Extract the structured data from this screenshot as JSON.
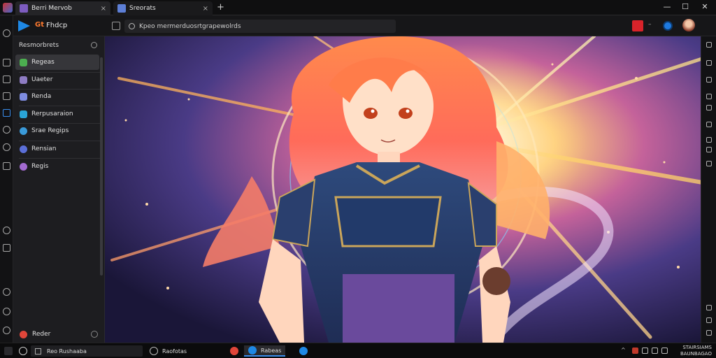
{
  "window": {
    "tabs": [
      {
        "label": "Berri Mervob",
        "close": "×"
      },
      {
        "label": "Sreorats",
        "close": "×"
      }
    ],
    "new_tab": "+",
    "controls": {
      "minimize": "—",
      "maximize": "☐",
      "close": "✕"
    }
  },
  "toolbar": {
    "brand_icon_text": "Gt",
    "brand_name": "Fhdcp",
    "address_value": "Kpeo mermerduosrtgrapewolrds"
  },
  "sidebar": {
    "header": "Resmorbrets",
    "items": [
      {
        "label": "Regeas",
        "color": "#4caf50",
        "selected": true
      },
      {
        "label": "Uaeter",
        "color": "#8e7cc3",
        "selected": false
      },
      {
        "label": "Renda",
        "color": "#7e8ce0",
        "selected": false
      },
      {
        "label": "Rerpusaraion",
        "color": "#2aa4d6",
        "selected": false
      },
      {
        "label": "Srae Regips",
        "color": "#3a9ad9",
        "selected": false
      },
      {
        "label": "Rensian",
        "color": "#5b6fd8",
        "selected": false
      },
      {
        "label": "Regis",
        "color": "#a36bd1",
        "selected": false
      }
    ],
    "footer": "Reder"
  },
  "taskbar": {
    "search_text": "Reo Rushaaba",
    "items": [
      {
        "label": "Raofotas",
        "color": "#2f2f34"
      },
      {
        "label": "",
        "color": "#e0463a"
      },
      {
        "label": "Rabeas",
        "color": "#1e88e5"
      },
      {
        "label": "",
        "color": "#1e88e5"
      }
    ],
    "clock": {
      "time": "STAIRSIAMS",
      "date": "BAUNBAGAO"
    }
  },
  "content": {
    "alt": "Anime illustration"
  }
}
